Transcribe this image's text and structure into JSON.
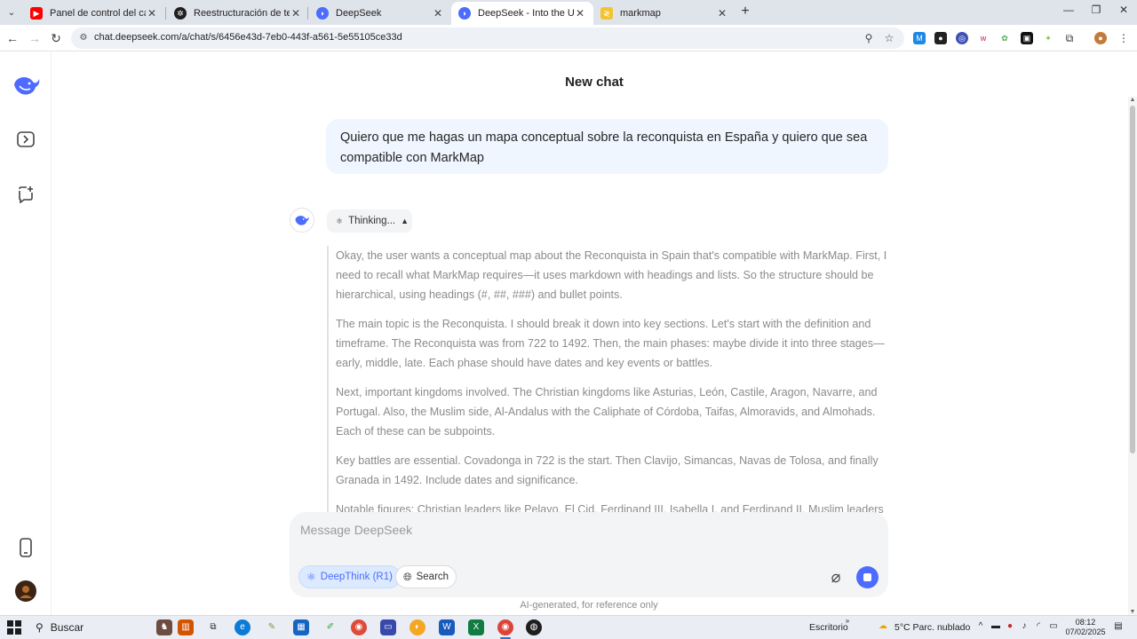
{
  "browser": {
    "tabs": [
      {
        "title": "Panel de control del canal - You",
        "icon": "youtube-icon",
        "active": false
      },
      {
        "title": "Reestructuración de texto",
        "icon": "chatgpt-icon",
        "active": false
      },
      {
        "title": "DeepSeek",
        "icon": "deepseek-icon",
        "active": false
      },
      {
        "title": "DeepSeek - Into the Unknown",
        "icon": "deepseek-icon",
        "active": true
      },
      {
        "title": "markmap",
        "icon": "markmap-icon",
        "active": false
      }
    ],
    "url": "chat.deepseek.com/a/chat/s/6456e43d-7eb0-443f-a561-5e55105ce33d"
  },
  "chat": {
    "title": "New chat",
    "user_message": "Quiero que me hagas un mapa conceptual sobre la reconquista en España y quiero que sea compatible con MarkMap",
    "thinking_label": "Thinking...",
    "thinking_paragraphs": [
      "Okay, the user wants a conceptual map about the Reconquista in Spain that's compatible with MarkMap. First, I need to recall what MarkMap requires—it uses markdown with headings and lists. So the structure should be hierarchical, using headings (#, ##, ###) and bullet points.",
      "The main topic is the Reconquista. I should break it down into key sections. Let's start with the definition and timeframe. The Reconquista was from 722 to 1492. Then, the main phases: maybe divide it into three stages—early, middle, late. Each phase should have dates and key events or battles.",
      "Next, important kingdoms involved. The Christian kingdoms like Asturias, León, Castile, Aragon, Navarre, and Portugal. Also, the Muslim side, Al-Andalus with the Caliphate of Córdoba, Taifas, Almoravids, and Almohads. Each of these can be subpoints.",
      "Key battles are essential. Covadonga in 722 is the start. Then Clavijo, Simancas, Navas de Tolosa, and finally Granada in 1492. Include dates and significance.",
      "Notable figures: Christian leaders like Pelayo, El Cid, Ferdinand III, Isabella I, and Ferdinand II. Muslim leaders like"
    ]
  },
  "composer": {
    "placeholder": "Message DeepSeek",
    "deepthink_label": "DeepThink (R1)",
    "search_label": "Search",
    "disclaimer": "AI-generated, for reference only"
  },
  "taskbar": {
    "search_label": "Buscar",
    "desktop_label": "Escritorio",
    "weather": "5°C  Parc. nublado",
    "time": "08:12",
    "date": "07/02/2025"
  },
  "colors": {
    "accent": "#4d6bfe",
    "bubble": "#eff6ff",
    "thinking_text": "#8b8b8b"
  }
}
